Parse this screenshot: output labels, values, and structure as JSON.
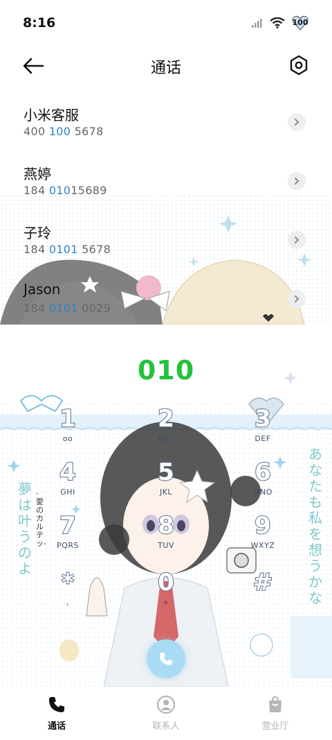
{
  "status_bar": {
    "time": "8:16",
    "battery": "100"
  },
  "header": {
    "title": "通话"
  },
  "contacts": [
    {
      "name": "小米客服",
      "number_parts": [
        "400 ",
        "100",
        " 5678"
      ]
    },
    {
      "name": "燕婷",
      "number_parts": [
        "184 ",
        "010",
        "15689"
      ]
    },
    {
      "name": "子玲",
      "number_parts": [
        "184 ",
        "0101",
        " 5678"
      ]
    },
    {
      "name": "Jason",
      "number_parts": [
        "184 ",
        "0101",
        " 0029"
      ]
    }
  ],
  "dialer": {
    "display": "010",
    "keys": [
      {
        "digit": "1",
        "letters": "oo"
      },
      {
        "digit": "2",
        "letters": "ABC"
      },
      {
        "digit": "3",
        "letters": "DEF"
      },
      {
        "digit": "4",
        "letters": "GHI"
      },
      {
        "digit": "5",
        "letters": "JKL"
      },
      {
        "digit": "6",
        "letters": "MNO"
      },
      {
        "digit": "7",
        "letters": "PQRS"
      },
      {
        "digit": "8",
        "letters": "TUV"
      },
      {
        "digit": "9",
        "letters": "WXYZ"
      },
      {
        "digit": "*",
        "letters": ","
      },
      {
        "digit": "0",
        "letters": "+"
      },
      {
        "digit": "#",
        "letters": ""
      }
    ],
    "theme_text_right": "あなたも私を想うかな",
    "theme_text_left": "夢は叶うのよ",
    "theme_text_small": "-愛のカルテッ-"
  },
  "tabs": [
    {
      "label": "通话",
      "icon": "phone-icon"
    },
    {
      "label": "联系人",
      "icon": "person-icon"
    },
    {
      "label": "营业厅",
      "icon": "bag-icon"
    }
  ],
  "colors": {
    "accent_green": "#22c33a",
    "highlight_blue": "#2a86c6",
    "call_button": "#a9dcf4"
  }
}
